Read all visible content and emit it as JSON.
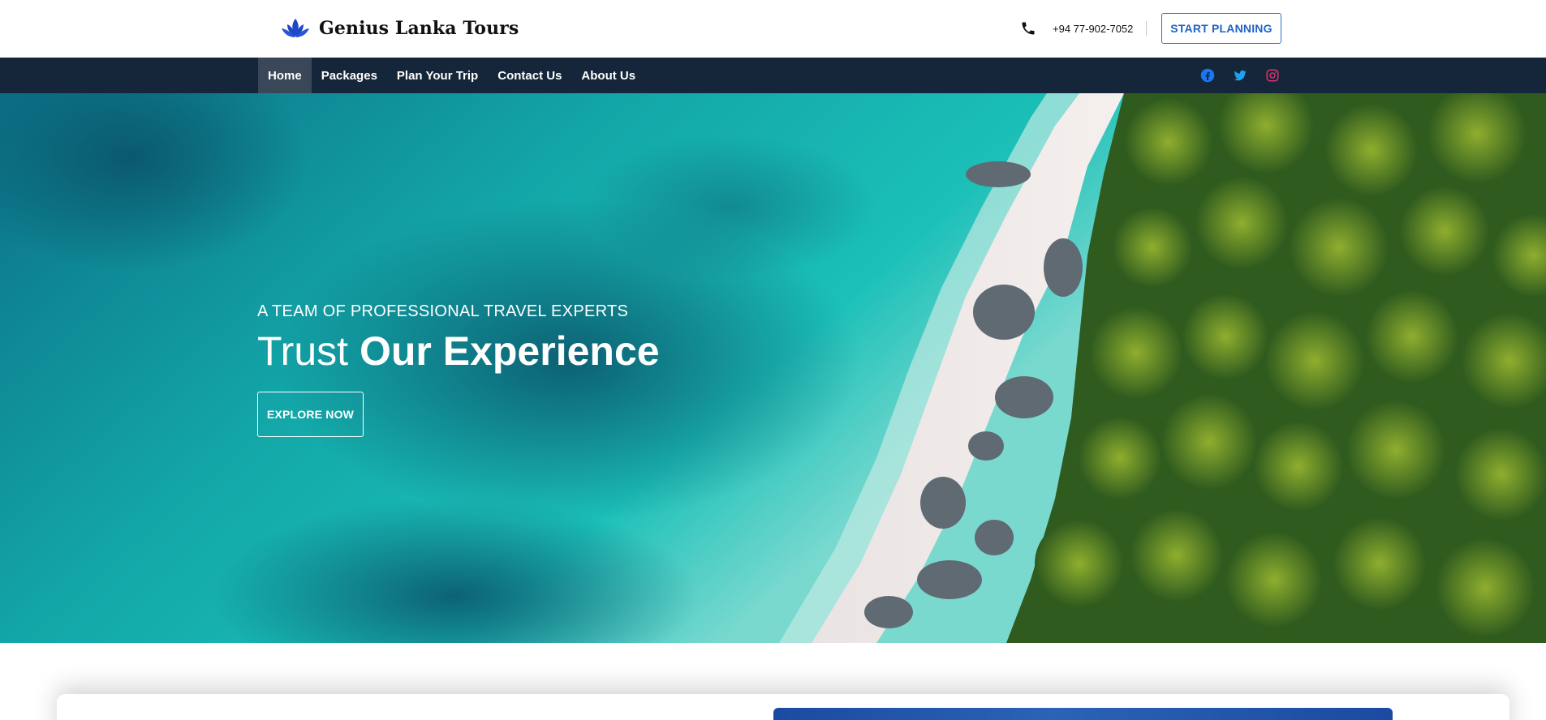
{
  "header": {
    "brand_name": "Genius Lanka Tours",
    "logo_icon": "lotus-icon",
    "phone": "+94 77-902-7052",
    "phone_icon": "phone-icon",
    "cta_label": "START PLANNING"
  },
  "nav": {
    "items": [
      {
        "label": "Home",
        "active": true
      },
      {
        "label": "Packages"
      },
      {
        "label": "Plan Your Trip"
      },
      {
        "label": "Contact Us"
      },
      {
        "label": "About Us"
      }
    ],
    "socials": [
      {
        "name": "facebook-icon",
        "color": "#1877f2"
      },
      {
        "name": "twitter-icon",
        "color": "#1da1f2"
      },
      {
        "name": "instagram-icon",
        "color": "#e1306c"
      }
    ]
  },
  "hero": {
    "kicker": "A TEAM OF PROFESSIONAL TRAVEL EXPERTS",
    "headline_light": "Trust",
    "headline_bold": "Our Experience",
    "button_label": "EXPLORE NOW"
  },
  "colors": {
    "nav_bg": "#15263a",
    "nav_active_bg": "#3a4758",
    "accent": "#1f63c4",
    "panel_blue": "#1b4aa2"
  }
}
